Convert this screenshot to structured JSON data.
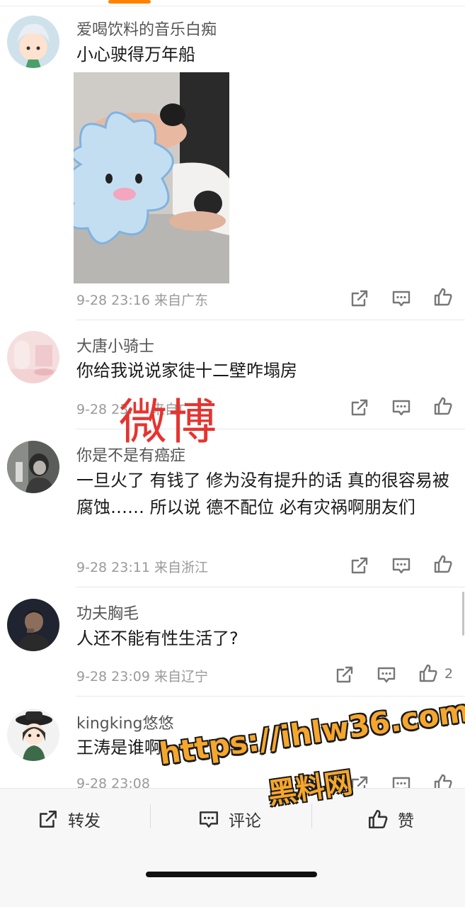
{
  "comments": [
    {
      "username": "爱喝饮料的音乐白痴",
      "text": "小心驶得万年船",
      "time": "9-28 23:16",
      "location": "来自广东",
      "likes": ""
    },
    {
      "username": "大唐小骑士",
      "text": "你给我说说家徒十二壁咋塌房",
      "time": "9-28 23:",
      "location": "来自广",
      "likes": ""
    },
    {
      "username": "你是不是有癌症",
      "text": "一旦火了  有钱了  修为没有提升的话  真的很容易被腐蚀……  所以说  德不配位  必有灾祸啊朋友们",
      "time": "9-28 23:11",
      "location": "来自浙江",
      "likes": ""
    },
    {
      "username": "功夫胸毛",
      "text": "人还不能有性生活了?",
      "time": "9-28 23:09",
      "location": "来自辽宁",
      "likes": "2"
    },
    {
      "username": "kingking悠悠",
      "text": "王涛是谁啊",
      "time": "9-28 23:08",
      "location": "",
      "likes": ""
    }
  ],
  "watermark": "微博",
  "promo": {
    "url": "https://ihlw36.com",
    "name": "黑料网"
  },
  "bottom_bar": {
    "repost": "转发",
    "comment": "评论",
    "like": "赞"
  },
  "icons": {
    "repost": "share-icon",
    "comment": "comment-icon",
    "like": "thumbs-up-icon"
  },
  "colors": {
    "accent": "#ff8200",
    "watermark": "#e53430",
    "promo": "#f6a62c"
  }
}
